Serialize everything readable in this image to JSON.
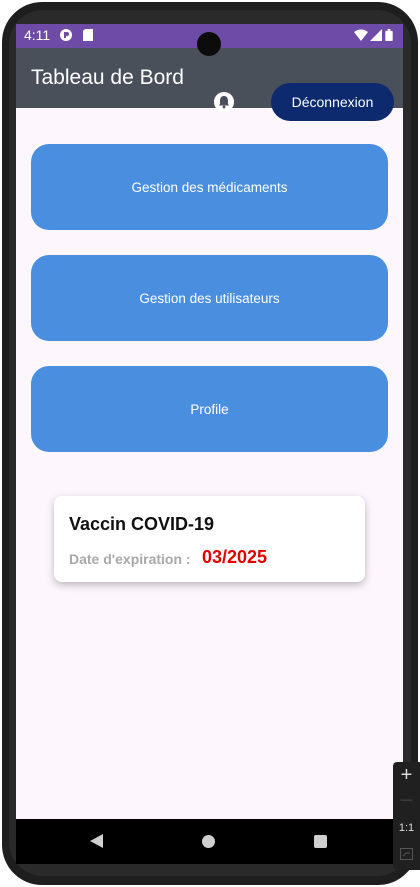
{
  "status_bar": {
    "time": "4:11"
  },
  "app_bar": {
    "title": "Tableau de Bord",
    "logout_label": "Déconnexion"
  },
  "menu": [
    {
      "label": "Gestion des médicaments"
    },
    {
      "label": "Gestion des utilisateurs"
    },
    {
      "label": "Profile"
    }
  ],
  "vaccine_card": {
    "name": "Vaccin COVID-19",
    "expiration_label": "Date d'expiration :",
    "expiration_value": "03/2025"
  },
  "emulator_tools": {
    "zoom_in": "+",
    "zoom_out": "—",
    "ratio": "1:1"
  },
  "colors": {
    "status_bar": "#6f4ba8",
    "app_bar": "#49505a",
    "logout_button": "#0d2a6e",
    "menu_button": "#4a8ee0",
    "expiration_value": "#e00000",
    "screen_background": "#fdf6fd"
  }
}
